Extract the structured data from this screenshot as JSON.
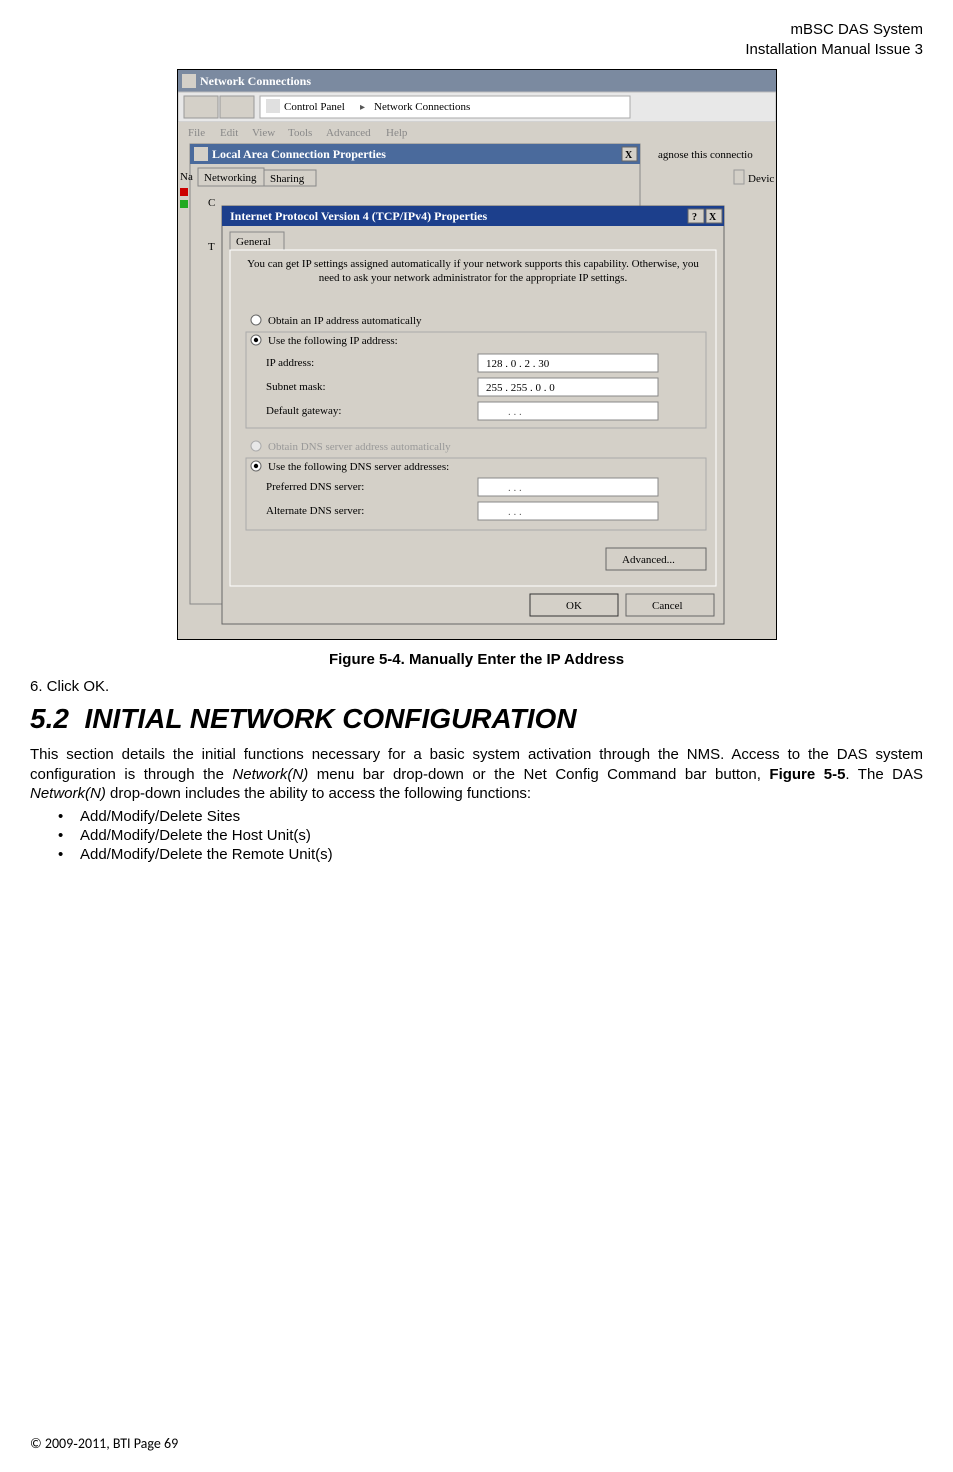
{
  "header": {
    "line1": "mBSC DAS System",
    "line2": "Installation Manual Issue 3"
  },
  "screenshot": {
    "window_title": "Network Connections",
    "breadcrumb_prefix": "Control Panel",
    "breadcrumb_sep": "▸",
    "breadcrumb_current": "Network Connections",
    "menubar": [
      "File",
      "Edit",
      "View",
      "Tools",
      "Advanced",
      "Help"
    ],
    "diagnose_text": "agnose this connectio",
    "na_label": "Na",
    "devic_label": "Devic",
    "lac_title": "Local Area Connection Properties",
    "lac_tab1": "Networking",
    "lac_tab2": "Sharing",
    "lac_c": "C",
    "lac_t": "T",
    "tcp_title": "Internet Protocol Version 4 (TCP/IPv4) Properties",
    "tcp_tab": "General",
    "tcp_desc": "You can get IP settings assigned automatically if your network supports this capability. Otherwise, you need to ask your network administrator for the appropriate IP settings.",
    "radio_obtain_ip": "Obtain an IP address automatically",
    "radio_use_ip": "Use the following IP address:",
    "ip_label": "IP address:",
    "ip_value": "128 .  0  .  2  .  30",
    "subnet_label": "Subnet mask:",
    "subnet_value": "255 . 255 .  0  .  0",
    "gateway_label": "Default gateway:",
    "gateway_value": ".        .        .",
    "radio_obtain_dns": "Obtain DNS server address automatically",
    "radio_use_dns": "Use the following DNS server addresses:",
    "pref_dns_label": "Preferred DNS server:",
    "pref_dns_value": ".        .        .",
    "alt_dns_label": "Alternate DNS server:",
    "alt_dns_value": ".        .        .",
    "advanced_btn": "Advanced...",
    "ok_btn": "OK",
    "cancel_btn": "Cancel",
    "help_q": "?",
    "close_x": "X"
  },
  "figure_caption": "Figure 5-4. Manually Enter the IP Address",
  "step6": "6.  Click OK.",
  "section": {
    "number": "5.2",
    "title": "INITIAL NETWORK CONFIGURATION"
  },
  "body": {
    "p1_a": "This section details the initial functions necessary for a basic system activation through the NMS. Access to the DAS system configuration is through the ",
    "p1_net1": "Network(N)",
    "p1_b": " menu bar drop-down or the Net Config Command bar button, ",
    "p1_figref": "Figure 5-5",
    "p1_c": ". The DAS ",
    "p1_net2": "Network(N)",
    "p1_d": " drop-down includes the ability to access the following functions:"
  },
  "bullets": {
    "b1": "Add/Modify/Delete Sites",
    "b2": "Add/Modify/Delete the Host Unit(s)",
    "b3": "Add/Modify/Delete the Remote Unit(s)"
  },
  "footer": "© 2009‐2011, BTI Page 69"
}
